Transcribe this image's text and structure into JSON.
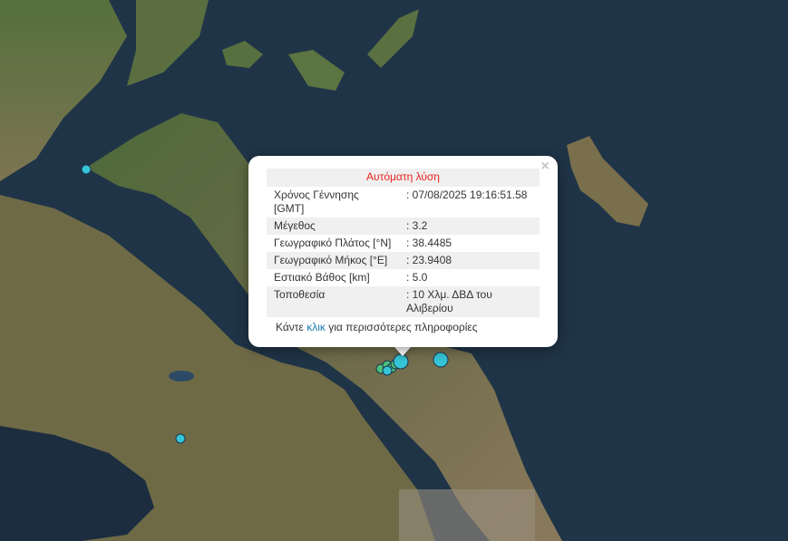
{
  "popup": {
    "close_label": "×",
    "title": "Αυτόματη λύση",
    "rows": [
      {
        "label": "Χρόνος Γέννησης [GMT]",
        "value": ": 07/08/2025 19:16:51.58"
      },
      {
        "label": "Μέγεθος",
        "value": ": 3.2"
      },
      {
        "label": "Γεωγραφικό Πλάτος [°N]",
        "value": ": 38.4485"
      },
      {
        "label": "Γεωγραφικό Μήκος [°E]",
        "value": ": 23.9408"
      },
      {
        "label": "Εστιακό Βάθος [km]",
        "value": ": 5.0"
      },
      {
        "label": "Τοποθεσία",
        "value": ": 10 Χλμ. ΔΒΔ του Αλιβερίου"
      }
    ],
    "more_prefix": "Κάντε ",
    "more_link": "κλικ",
    "more_suffix": " για περισσότερες πληροφορίες"
  },
  "colors": {
    "sea": "#1f3447",
    "marker_cyan": "#36c5d6",
    "marker_green": "#4cc17a",
    "alert_red": "#e8231f",
    "link": "#1a7fb5"
  }
}
